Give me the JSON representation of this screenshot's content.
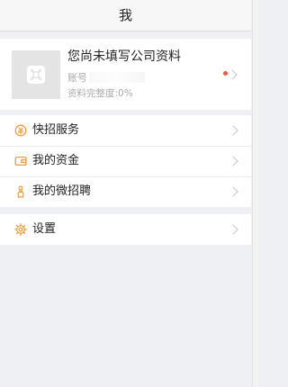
{
  "nav": {
    "title": "我"
  },
  "profile": {
    "company_text": "您尚未填写公司资料",
    "account_label": "账号",
    "completeness_label": "资料完整度",
    "completeness_value": ":0%"
  },
  "menu": {
    "group1": [
      {
        "label": "快招服务",
        "icon": "service-icon"
      },
      {
        "label": "我的资金",
        "icon": "wallet-icon"
      },
      {
        "label": "我的微招聘",
        "icon": "recruit-icon"
      }
    ],
    "group2": [
      {
        "label": "设置",
        "icon": "gear-icon"
      }
    ]
  },
  "colors": {
    "accent": "#f29b38",
    "badge": "#f0583a",
    "background": "#eff0f4"
  }
}
